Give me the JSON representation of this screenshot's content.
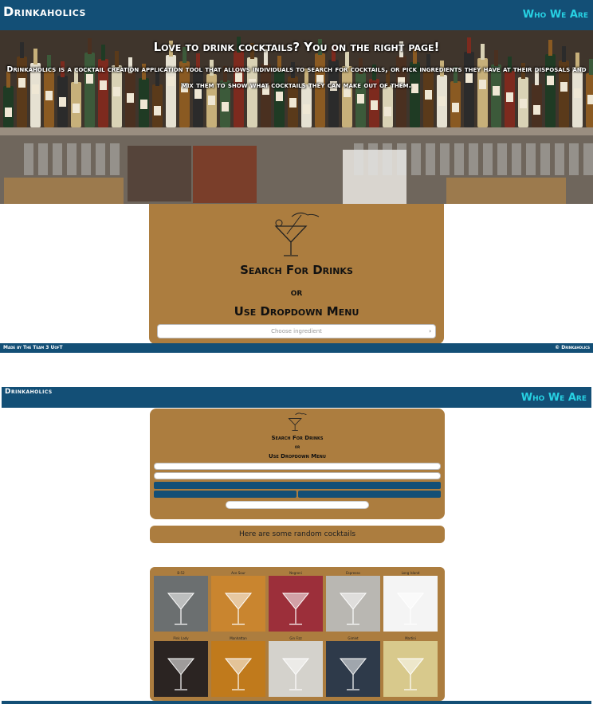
{
  "nav": {
    "brand": "Drinkaholics",
    "who_we_are": "Who We Are"
  },
  "hero": {
    "title": "Love to drink cocktails? You on the right page!",
    "description": "Drinkaholics is a cocktail creation application tool that allows individuals to search for cocktails, or pick ingredients they have at their disposals and mix them to show what cocktails they can make out of them."
  },
  "search": {
    "title": "Search For Drinks",
    "or": "or",
    "dropdown_title": "Use Dropdown Menu",
    "select_placeholder": "Choose ingredient"
  },
  "footer": {
    "left": "Made by The Team 3 UofT",
    "right": "© Drinkaholics"
  },
  "random": {
    "heading": "Here are some random cocktails"
  },
  "drinks": [
    {
      "name": "B-52",
      "color": "#6b6f70"
    },
    {
      "name": "Ace Sour",
      "color": "#c9852f"
    },
    {
      "name": "Negroni",
      "color": "#9c2f3a"
    },
    {
      "name": "Espresso",
      "color": "#b9b7b2"
    },
    {
      "name": "Long Island",
      "color": "#f4f4f4"
    },
    {
      "name": "Pink Lady",
      "color": "#2b2422"
    },
    {
      "name": "Manhattan",
      "color": "#c07a1c"
    },
    {
      "name": "Gin Fizz",
      "color": "#d4d2cc"
    },
    {
      "name": "Gimlet",
      "color": "#2e3a4a"
    },
    {
      "name": "Martini",
      "color": "#d8c98c"
    }
  ]
}
